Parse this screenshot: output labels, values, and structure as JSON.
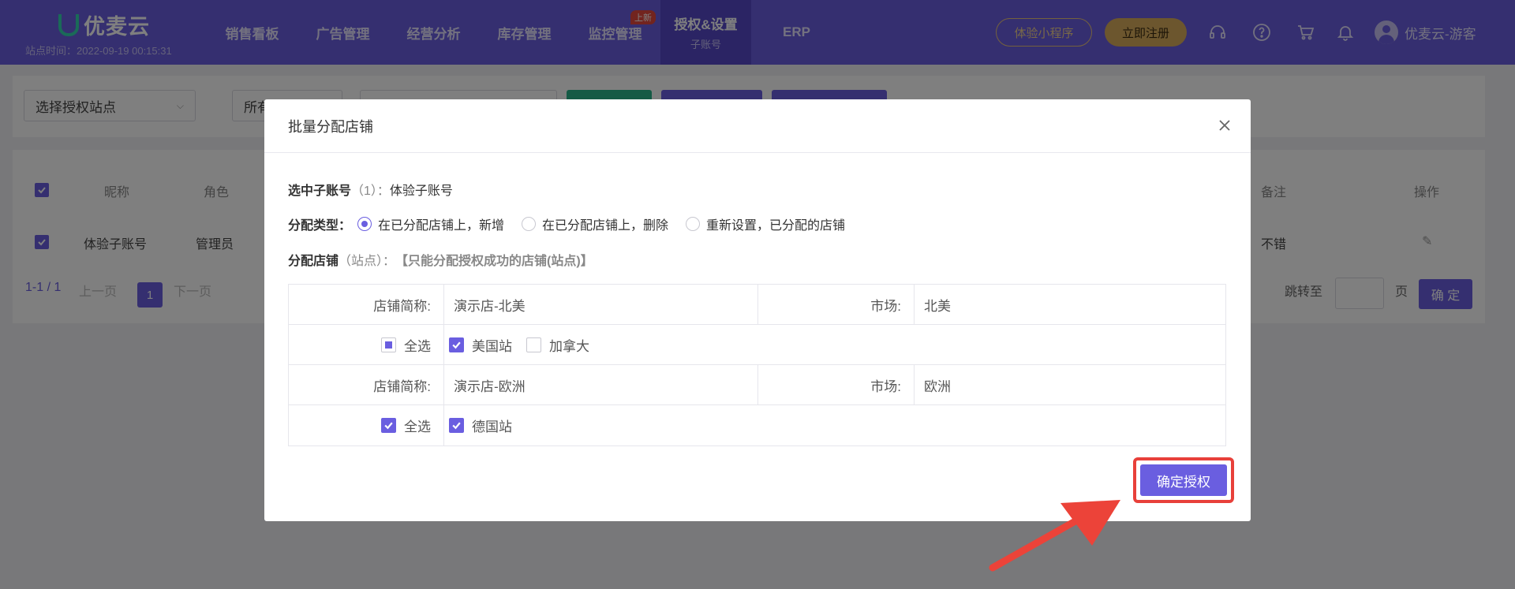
{
  "brand": {
    "name": "优麦云",
    "site_time": "站点时间：2022-09-19 00:15:31"
  },
  "nav": [
    {
      "label": "销售看板",
      "sub": "",
      "badge": ""
    },
    {
      "label": "广告管理",
      "sub": "",
      "badge": ""
    },
    {
      "label": "经营分析",
      "sub": "",
      "badge": ""
    },
    {
      "label": "库存管理",
      "sub": "",
      "badge": ""
    },
    {
      "label": "监控管理",
      "sub": "",
      "badge": "上新"
    },
    {
      "label": "授权&设置",
      "sub": "子账号",
      "badge": "",
      "active": true
    },
    {
      "label": "ERP",
      "sub": "",
      "badge": ""
    }
  ],
  "header_actions": {
    "mini_program": "体验小程序",
    "register": "立即注册",
    "user_name": "优麦云-游客"
  },
  "icons": [
    "headset-icon",
    "help-icon",
    "cart-icon",
    "bell-icon",
    "avatar-icon"
  ],
  "filter": {
    "site_select": "选择授权站点",
    "type_select": "所有"
  },
  "table": {
    "headers": {
      "nickname": "昵称",
      "role": "角色",
      "note": "备注",
      "action": "操作"
    },
    "row": {
      "nickname": "体验子账号",
      "role": "管理员",
      "note": "不错"
    }
  },
  "pagination": {
    "range": "1-1 / 1",
    "prev": "上一页",
    "current": "1",
    "next": "下一页",
    "jump_label": "跳转至",
    "page_unit": "页",
    "confirm": "确 定"
  },
  "modal": {
    "title": "批量分配店铺",
    "selected_label": "选中子账号",
    "selected_count": "（1）：",
    "selected_name": "体验子账号",
    "type_label": "分配类型：",
    "type_options": [
      "在已分配店铺上，新增",
      "在已分配店铺上，删除",
      "重新设置，已分配的店铺"
    ],
    "type_selected": 0,
    "store_label": "分配店铺",
    "store_paren": "（站点）：",
    "store_hint": "【只能分配授权成功的店铺(站点)】",
    "shop_label": "店铺简称:",
    "market_label": "市场:",
    "select_all": "全选",
    "shops": [
      {
        "name": "演示店-北美",
        "market": "北美",
        "sites": [
          {
            "name": "美国站",
            "checked": true
          },
          {
            "name": "加拿大",
            "checked": false
          }
        ],
        "all": "partial"
      },
      {
        "name": "演示店-欧洲",
        "market": "欧洲",
        "sites": [
          {
            "name": "德国站",
            "checked": true
          }
        ],
        "all": "checked"
      }
    ],
    "confirm_button": "确定授权"
  },
  "colors": {
    "primary": "#6a5ee0",
    "highlight": "#e8403a",
    "gold": "#d8ac5d"
  }
}
